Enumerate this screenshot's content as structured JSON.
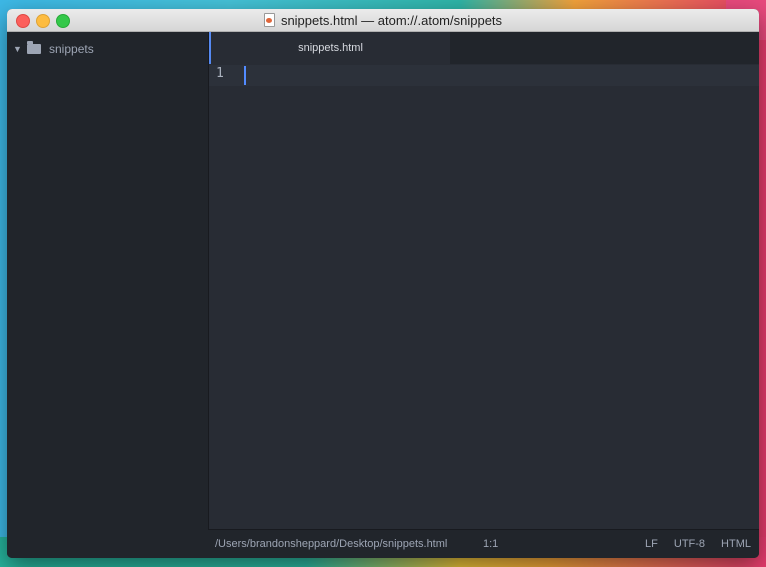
{
  "window": {
    "title": "snippets.html — atom://.atom/snippets"
  },
  "tree": {
    "root_label": "snippets"
  },
  "tabs": [
    {
      "label": "snippets.html",
      "active": true
    }
  ],
  "editor": {
    "line_numbers": [
      "1"
    ]
  },
  "status": {
    "path": "/Users/brandonsheppard/Desktop/snippets.html",
    "cursor_position": "1:1",
    "line_ending": "LF",
    "encoding": "UTF-8",
    "grammar": "HTML"
  },
  "colors": {
    "accent": "#568af2",
    "panel": "#21252b",
    "editor_bg": "#282c34"
  }
}
